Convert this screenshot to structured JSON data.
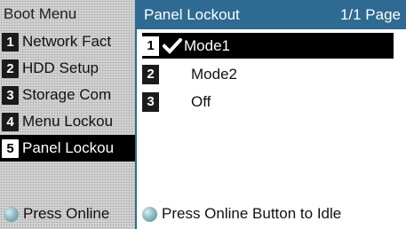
{
  "background_menu": {
    "title": "Boot Menu",
    "items": [
      {
        "number": "1",
        "label": "Network Fact"
      },
      {
        "number": "2",
        "label": "HDD Setup"
      },
      {
        "number": "3",
        "label": "Storage Com"
      },
      {
        "number": "4",
        "label": "Menu Lockou"
      },
      {
        "number": "5",
        "label": "Panel Lockou"
      }
    ],
    "selected_index": 4,
    "footer": "Press Online"
  },
  "dialog": {
    "title": "Panel Lockout",
    "page": "1/1 Page",
    "options": [
      {
        "number": "1",
        "label": "Mode1",
        "checked": true
      },
      {
        "number": "2",
        "label": "Mode2",
        "checked": false
      },
      {
        "number": "3",
        "label": "Off",
        "checked": false
      }
    ],
    "selected_index": 0,
    "footer": "Press Online Button to Idle"
  },
  "icons": {
    "online": "online-button-icon",
    "check": "check-mark-icon"
  },
  "colors": {
    "header_bg": "#2e6a92",
    "selected_bg": "#000000"
  }
}
